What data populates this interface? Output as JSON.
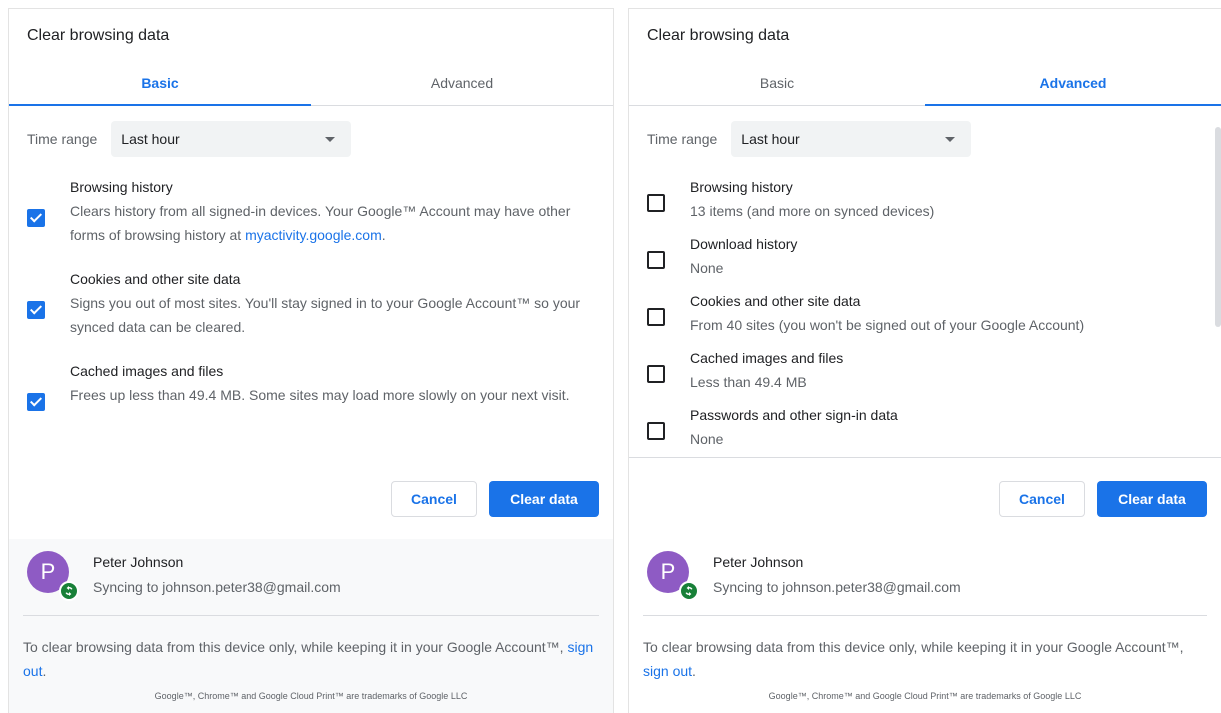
{
  "left": {
    "title": "Clear browsing data",
    "tabs": [
      "Basic",
      "Advanced"
    ],
    "active_tab": "Basic",
    "time_range_label": "Time range",
    "time_range_value": "Last hour",
    "items": [
      {
        "name": "Browsing history",
        "desc": "Clears history from all signed-in devices. Your Google™ Account may have other forms of browsing history at ",
        "link": "myactivity.google.com",
        "desc_after": ".",
        "checked": true
      },
      {
        "name": "Cookies and other site data",
        "desc": "Signs you out of most sites. You'll stay signed in to your Google Account™ so your synced data can be cleared.",
        "checked": true
      },
      {
        "name": "Cached images and files",
        "desc": "Frees up less than 49.4 MB. Some sites may load more slowly on your next visit.",
        "checked": true
      }
    ],
    "cancel_label": "Cancel",
    "clear_label": "Clear data",
    "account": {
      "initial": "P",
      "name": "Peter Johnson",
      "sync_text": "Syncing to johnson.peter38@gmail.com"
    },
    "info_text": "To clear browsing data from this device only, while keeping it in your Google Account™, ",
    "sign_out_label": "sign out",
    "info_after": ".",
    "trademark": "Google™, Chrome™ and Google Cloud Print™ are trademarks of Google LLC"
  },
  "right": {
    "title": "Clear browsing data",
    "tabs": [
      "Basic",
      "Advanced"
    ],
    "active_tab": "Advanced",
    "time_range_label": "Time range",
    "time_range_value": "Last hour",
    "items": [
      {
        "name": "Browsing history",
        "desc": "13 items (and more on synced devices)",
        "checked": false
      },
      {
        "name": "Download history",
        "desc": "None",
        "checked": false
      },
      {
        "name": "Cookies and other site data",
        "desc": "From 40 sites (you won't be signed out of your Google Account)",
        "checked": false
      },
      {
        "name": "Cached images and files",
        "desc": "Less than 49.4 MB",
        "checked": false
      },
      {
        "name": "Passwords and other sign-in data",
        "desc": "None",
        "checked": false
      }
    ],
    "cancel_label": "Cancel",
    "clear_label": "Clear data",
    "account": {
      "initial": "P",
      "name": "Peter Johnson",
      "sync_text": "Syncing to johnson.peter38@gmail.com"
    },
    "info_text": "To clear browsing data from this device only, while keeping it in your Google Account™, ",
    "sign_out_label": "sign out",
    "info_after": ".",
    "trademark": "Google™, Chrome™ and Google Cloud Print™ are trademarks of Google LLC"
  },
  "colors": {
    "accent": "#1a73e8",
    "avatar": "#8e5bc4",
    "sync": "#188038"
  },
  "icons": {
    "dropdown": "caret-down-icon",
    "checkbox": "checkbox-icon",
    "sync": "sync-icon"
  }
}
